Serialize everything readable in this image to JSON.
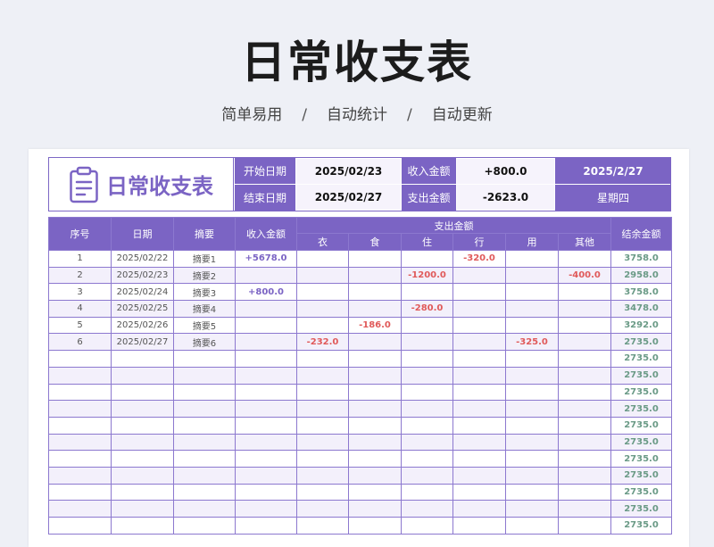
{
  "title": "日常收支表",
  "subtitle": [
    "简单易用",
    "自动统计",
    "自动更新"
  ],
  "subtitle_separator": "/",
  "header": {
    "logo_text": "日常收支表",
    "start_label": "开始日期",
    "start_value": "2025/02/23",
    "end_label": "结束日期",
    "end_value": "2025/02/27",
    "income_label": "收入金额",
    "income_value": "+800.0",
    "expense_label": "支出金额",
    "expense_value": "-2623.0",
    "today": "2025/2/27",
    "weekday": "星期四"
  },
  "columns": {
    "no": "序号",
    "date": "日期",
    "summary": "摘要",
    "income": "收入金额",
    "expense": "支出金额",
    "balance": "结余金额",
    "expense_sub": [
      "衣",
      "食",
      "住",
      "行",
      "用",
      "其他"
    ]
  },
  "rows": [
    {
      "no": "1",
      "date": "2025/02/22",
      "summary": "摘要1",
      "income": "+5678.0",
      "exp": [
        "",
        "",
        "",
        "-320.0",
        "",
        ""
      ],
      "balance": "3758.0"
    },
    {
      "no": "2",
      "date": "2025/02/23",
      "summary": "摘要2",
      "income": "",
      "exp": [
        "",
        "",
        "-1200.0",
        "",
        "",
        "-400.0"
      ],
      "balance": "2958.0"
    },
    {
      "no": "3",
      "date": "2025/02/24",
      "summary": "摘要3",
      "income": "+800.0",
      "exp": [
        "",
        "",
        "",
        "",
        "",
        ""
      ],
      "balance": "3758.0"
    },
    {
      "no": "4",
      "date": "2025/02/25",
      "summary": "摘要4",
      "income": "",
      "exp": [
        "",
        "",
        "-280.0",
        "",
        "",
        ""
      ],
      "balance": "3478.0"
    },
    {
      "no": "5",
      "date": "2025/02/26",
      "summary": "摘要5",
      "income": "",
      "exp": [
        "",
        "-186.0",
        "",
        "",
        "",
        ""
      ],
      "balance": "3292.0"
    },
    {
      "no": "6",
      "date": "2025/02/27",
      "summary": "摘要6",
      "income": "",
      "exp": [
        "-232.0",
        "",
        "",
        "",
        "-325.0",
        ""
      ],
      "balance": "2735.0"
    },
    {
      "no": "",
      "date": "",
      "summary": "",
      "income": "",
      "exp": [
        "",
        "",
        "",
        "",
        "",
        ""
      ],
      "balance": "2735.0"
    },
    {
      "no": "",
      "date": "",
      "summary": "",
      "income": "",
      "exp": [
        "",
        "",
        "",
        "",
        "",
        ""
      ],
      "balance": "2735.0"
    },
    {
      "no": "",
      "date": "",
      "summary": "",
      "income": "",
      "exp": [
        "",
        "",
        "",
        "",
        "",
        ""
      ],
      "balance": "2735.0"
    },
    {
      "no": "",
      "date": "",
      "summary": "",
      "income": "",
      "exp": [
        "",
        "",
        "",
        "",
        "",
        ""
      ],
      "balance": "2735.0"
    },
    {
      "no": "",
      "date": "",
      "summary": "",
      "income": "",
      "exp": [
        "",
        "",
        "",
        "",
        "",
        ""
      ],
      "balance": "2735.0"
    },
    {
      "no": "",
      "date": "",
      "summary": "",
      "income": "",
      "exp": [
        "",
        "",
        "",
        "",
        "",
        ""
      ],
      "balance": "2735.0"
    },
    {
      "no": "",
      "date": "",
      "summary": "",
      "income": "",
      "exp": [
        "",
        "",
        "",
        "",
        "",
        ""
      ],
      "balance": "2735.0"
    },
    {
      "no": "",
      "date": "",
      "summary": "",
      "income": "",
      "exp": [
        "",
        "",
        "",
        "",
        "",
        ""
      ],
      "balance": "2735.0"
    },
    {
      "no": "",
      "date": "",
      "summary": "",
      "income": "",
      "exp": [
        "",
        "",
        "",
        "",
        "",
        ""
      ],
      "balance": "2735.0"
    },
    {
      "no": "",
      "date": "",
      "summary": "",
      "income": "",
      "exp": [
        "",
        "",
        "",
        "",
        "",
        ""
      ],
      "balance": "2735.0"
    },
    {
      "no": "",
      "date": "",
      "summary": "",
      "income": "",
      "exp": [
        "",
        "",
        "",
        "",
        "",
        ""
      ],
      "balance": "2735.0"
    }
  ],
  "colors": {
    "accent": "#7b64c4",
    "income": "#7b64c4",
    "expense": "#e05a5a",
    "balance": "#6a9a86",
    "row_alt": "#f3f0fb"
  },
  "icons": {
    "logo": "clipboard-icon"
  }
}
